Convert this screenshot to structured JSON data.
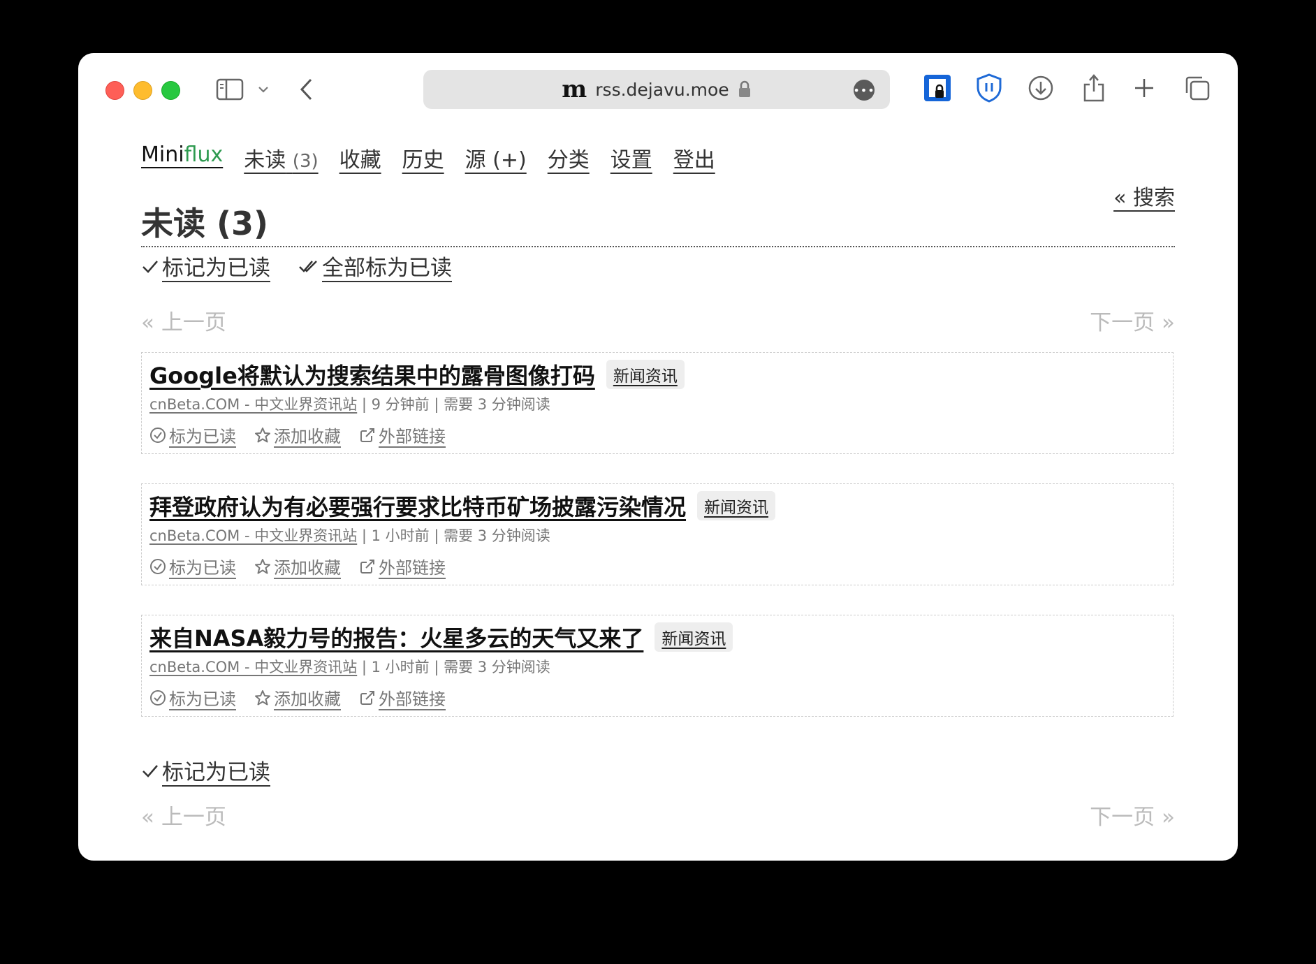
{
  "browser": {
    "url": "rss.dejavu.moe",
    "site_glyph": "m"
  },
  "nav": {
    "brand_main": "Mini",
    "brand_accent": "flux",
    "unread_label": "未读",
    "unread_count": "(3)",
    "starred": "收藏",
    "history": "历史",
    "feeds": "源 (+)",
    "categories": "分类",
    "settings": "设置",
    "logout": "登出"
  },
  "search_link": "« 搜索",
  "page_title": "未读 (3)",
  "top_actions": {
    "mark_page_read": "标记为已读",
    "mark_all_read": "全部标为已读"
  },
  "pager": {
    "prev": "« 上一页",
    "next": "下一页 »"
  },
  "entries": [
    {
      "title": "Google将默认为搜索结果中的露骨图像打码",
      "category": "新闻资讯",
      "feed": "cnBeta.COM - 中文业界资讯站",
      "meta": " | 9 分钟前 | 需要 3 分钟阅读",
      "mark_read": "标为已读",
      "star": "添加收藏",
      "external": "外部链接"
    },
    {
      "title": "拜登政府认为有必要强行要求比特币矿场披露污染情况",
      "category": "新闻资讯",
      "feed": "cnBeta.COM - 中文业界资讯站",
      "meta": " | 1 小时前 | 需要 3 分钟阅读",
      "mark_read": "标为已读",
      "star": "添加收藏",
      "external": "外部链接"
    },
    {
      "title": "来自NASA毅力号的报告：火星多云的天气又来了",
      "category": "新闻资讯",
      "feed": "cnBeta.COM - 中文业界资讯站",
      "meta": " | 1 小时前 | 需要 3 分钟阅读",
      "mark_read": "标为已读",
      "star": "添加收藏",
      "external": "外部链接"
    }
  ],
  "bottom_actions": {
    "mark_page_read": "标记为已读"
  },
  "colors": {
    "accent": "#2e9a50",
    "text": "#333333",
    "muted": "#777777"
  }
}
